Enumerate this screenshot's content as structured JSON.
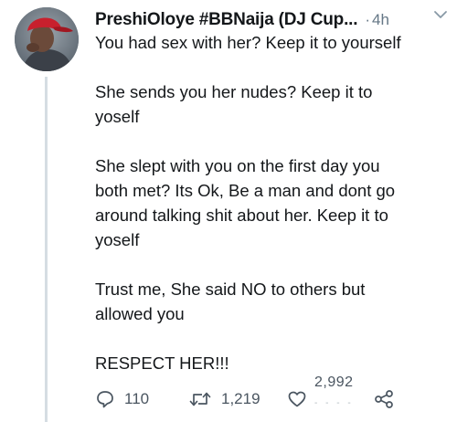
{
  "tweet": {
    "display_name": "PreshiOloye #BBNaija (DJ Cup...",
    "separator": "·",
    "time": "4h",
    "paragraphs": [
      "You had sex with her? Keep it to yourself",
      "She sends you her nudes? Keep it to\nyoself",
      "She slept with you on the first day you\nboth met? Its Ok, Be a man and dont go\naround talking shit about her. Keep it to\nyoself",
      "Trust me, She said NO to others but\nallowed you",
      "RESPECT HER!!!"
    ],
    "actions": {
      "replies": "110",
      "retweets": "1,219",
      "likes": "2,992"
    }
  },
  "icons": {
    "avatar": "profile-photo",
    "caret": "chevron-down-icon",
    "reply": "reply-bubble-icon",
    "retweet": "retweet-arrows-icon",
    "like": "heart-icon",
    "share": "share-icon"
  },
  "colors": {
    "text": "#14171a",
    "muted": "#657786",
    "thread_line": "#d5dde3"
  }
}
